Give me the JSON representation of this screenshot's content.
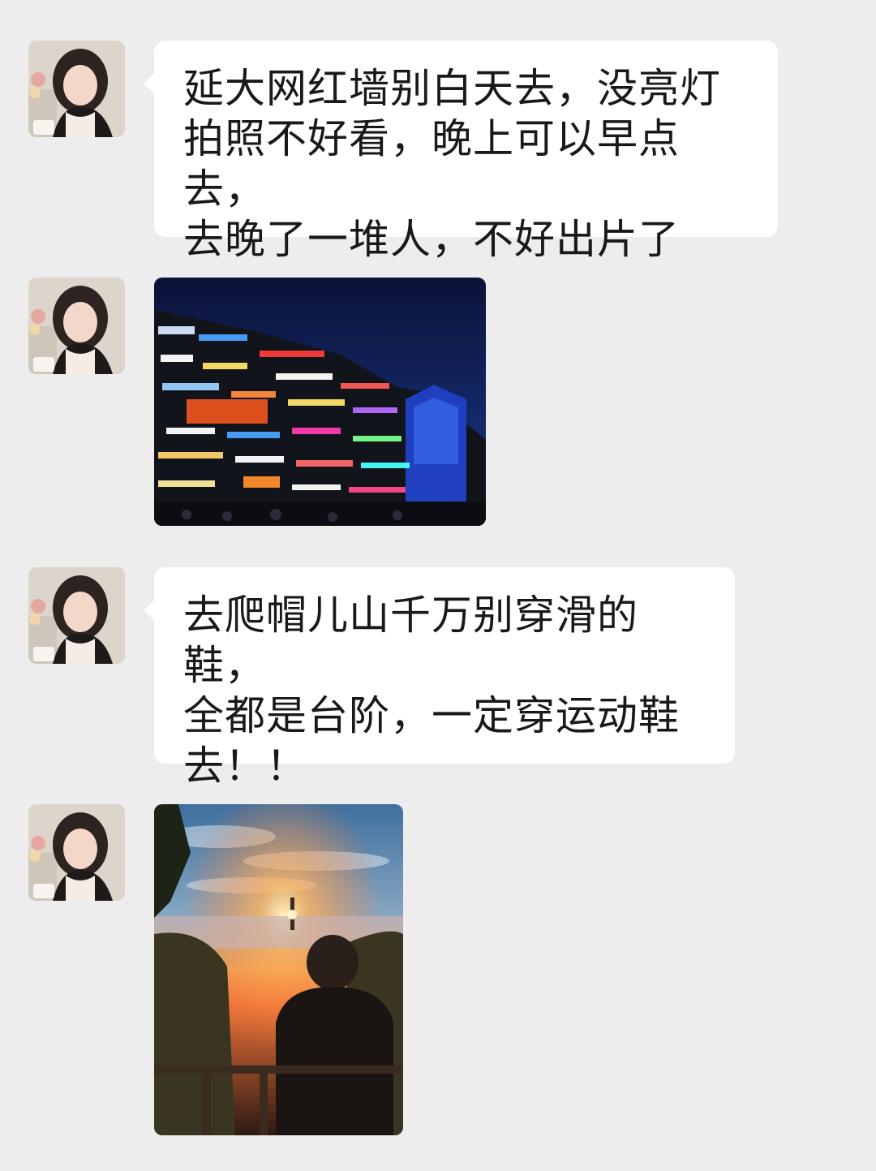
{
  "messages": [
    {
      "type": "text",
      "text": "延大网红墙别白天去，没亮灯\n拍照不好看，晚上可以早点去，\n去晚了一堆人，不好出片了"
    },
    {
      "type": "image",
      "image_description_icon": "city-night-neon-photo"
    },
    {
      "type": "text",
      "text": "去爬帽儿山千万别穿滑的鞋，\n全都是台阶，一定穿运动鞋\n去！！"
    },
    {
      "type": "image",
      "image_description_icon": "sunset-mountain-photo"
    }
  ],
  "colors": {
    "background": "#ededed",
    "bubble": "#ffffff",
    "text": "#191919"
  }
}
